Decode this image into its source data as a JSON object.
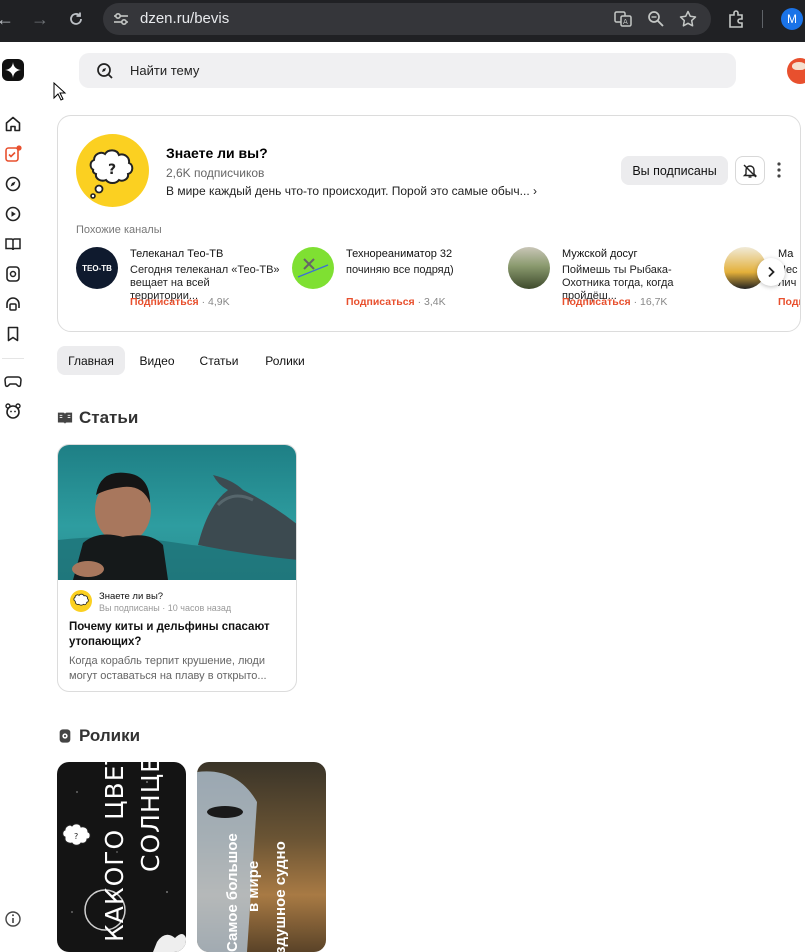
{
  "browser": {
    "url": "dzen.ru/bevis",
    "profile_initial": "M"
  },
  "search": {
    "placeholder": "Найти тему"
  },
  "channel": {
    "name": "Знаете ли вы?",
    "subscribers": "2,6K подписчиков",
    "description": "В мире каждый день что-то происходит. Порой это самые обыч...",
    "subscribed_label": "Вы подписаны",
    "accent_color": "#e8502e",
    "avatar_color": "#fbd021"
  },
  "similar": {
    "label": "Похожие каналы",
    "items": [
      {
        "name": "Телеканал Тео-ТВ",
        "desc": "Сегодня телеканал «Тео-ТВ» вещает на всей территории...",
        "subscribe": "Подписаться",
        "count": "· 4,9K",
        "logo_text": "ТЕО-ТВ"
      },
      {
        "name": "Технореаниматор 32",
        "desc": "починяю все подряд)",
        "subscribe": "Подписаться",
        "count": "· 3,4K"
      },
      {
        "name": "Мужской досуг",
        "desc": "Поймешь ты Рыбака-Охотника тогда, когда пройдёш...",
        "subscribe": "Подписаться",
        "count": "· 16,7K"
      },
      {
        "name": "Ма",
        "desc": "Нес лич",
        "subscribe": "Подп",
        "count": ""
      }
    ]
  },
  "tabs": [
    "Главная",
    "Видео",
    "Статьи",
    "Ролики"
  ],
  "sections": {
    "articles": "Статьи",
    "shorts": "Ролики"
  },
  "article": {
    "channel": "Знаете ли вы?",
    "meta": "Вы подписаны · 10 часов назад",
    "title": "Почему киты и дельфины спасают утопающих?",
    "snippet": "Когда корабль терпит крушение, люди могут оставаться на плаву в открыто..."
  },
  "shorts": [
    {
      "title_line1": "КАКОГО ЦВЕТА",
      "title_line2": "СОЛНЦЕ?"
    },
    {
      "title_line1": "Самое большое",
      "title_line2": "в мире",
      "title_line3": "воздушное судно"
    }
  ]
}
